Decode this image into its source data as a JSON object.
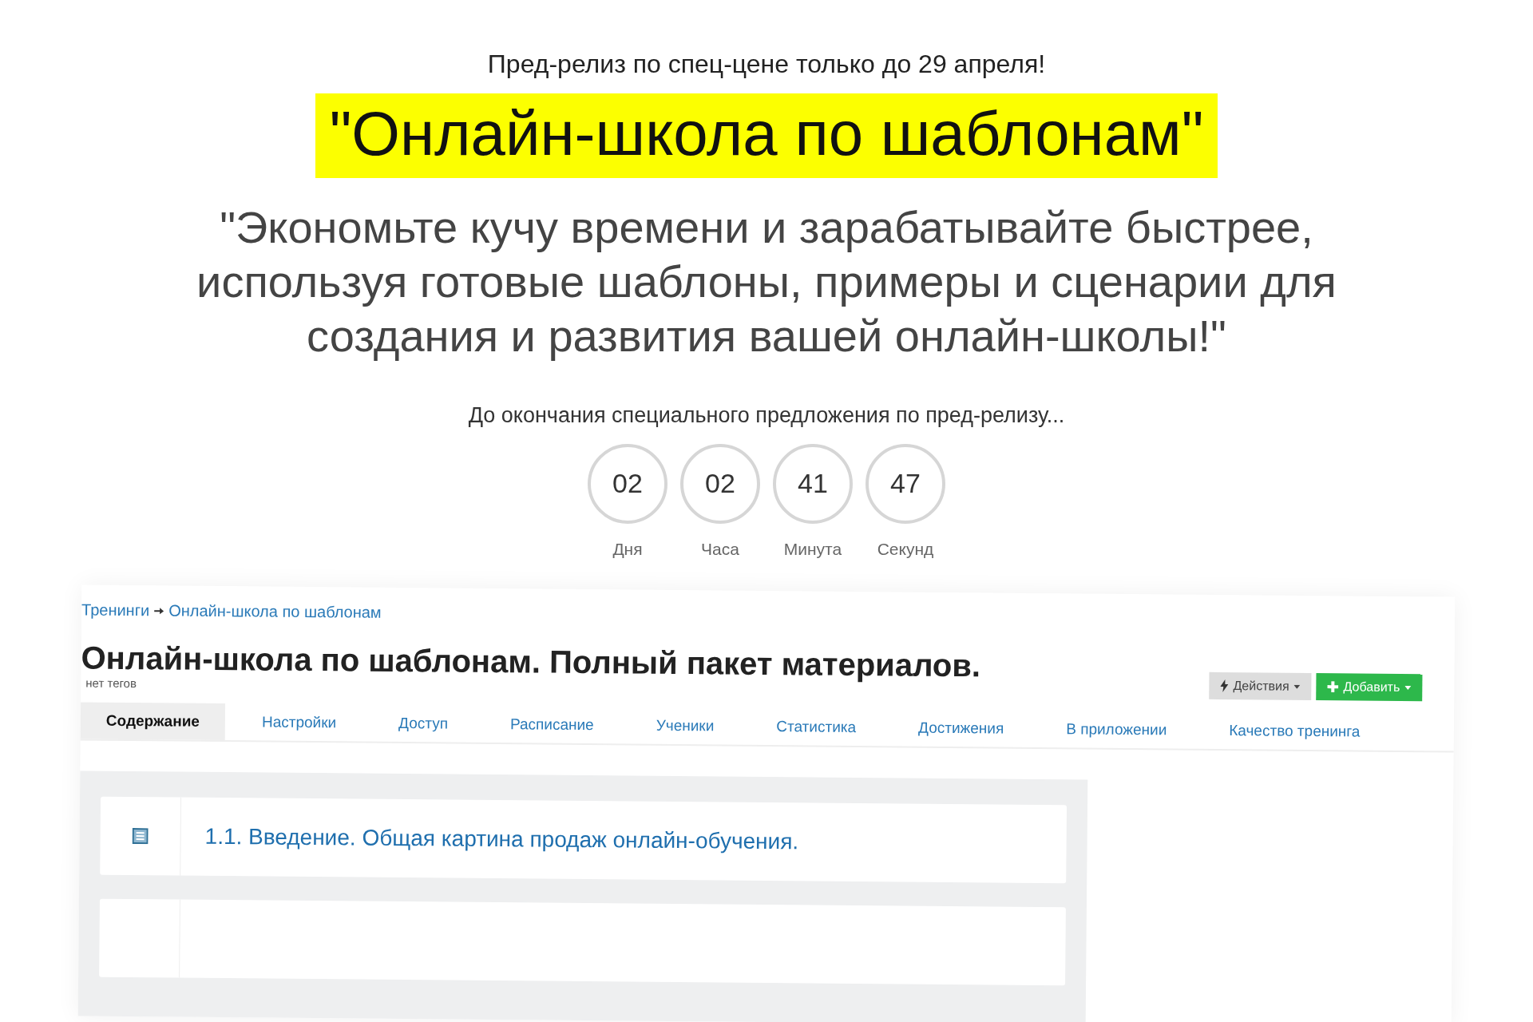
{
  "promo": {
    "pretitle": "Пред-релиз по спец-цене только до 29 апреля!",
    "headline": "\"Онлайн-школа по шаблонам\"",
    "quote": "\"Экономьте кучу времени и зарабатывайте быстрее, используя готовые шаблоны, примеры и сценарии для создания и развития вашей онлайн-школы!\""
  },
  "countdown": {
    "caption": "До окончания специального предложения по пред-релизу...",
    "units": [
      {
        "value": "02",
        "label": "Дня"
      },
      {
        "value": "02",
        "label": "Часа"
      },
      {
        "value": "41",
        "label": "Минута"
      },
      {
        "value": "47",
        "label": "Секунд"
      }
    ]
  },
  "app_preview": {
    "breadcrumb": [
      "Тренинги",
      "Онлайн-школа по шаблонам"
    ],
    "title": "Онлайн-школа по шаблонам. Полный пакет материалов.",
    "tags": "нет тегов",
    "buttons": [
      {
        "label": "Действия",
        "kind": "actions"
      },
      {
        "label": "Добавить",
        "kind": "add"
      }
    ],
    "tabs": [
      {
        "label": "Содержание",
        "selected": true
      },
      {
        "label": "Настройки",
        "selected": false
      },
      {
        "label": "Доступ",
        "selected": false
      },
      {
        "label": "Расписание",
        "selected": false
      },
      {
        "label": "Ученики",
        "selected": false
      },
      {
        "label": "Статистика",
        "selected": false
      },
      {
        "label": "Достижения",
        "selected": false
      },
      {
        "label": "В приложении",
        "selected": false
      },
      {
        "label": "Качество тренинга",
        "selected": false
      }
    ],
    "lessons": [
      {
        "kind": "lesson",
        "title": "1.1. Введение. Общая картина продаж онлайн-обучения."
      },
      {
        "kind": "blank"
      }
    ]
  }
}
